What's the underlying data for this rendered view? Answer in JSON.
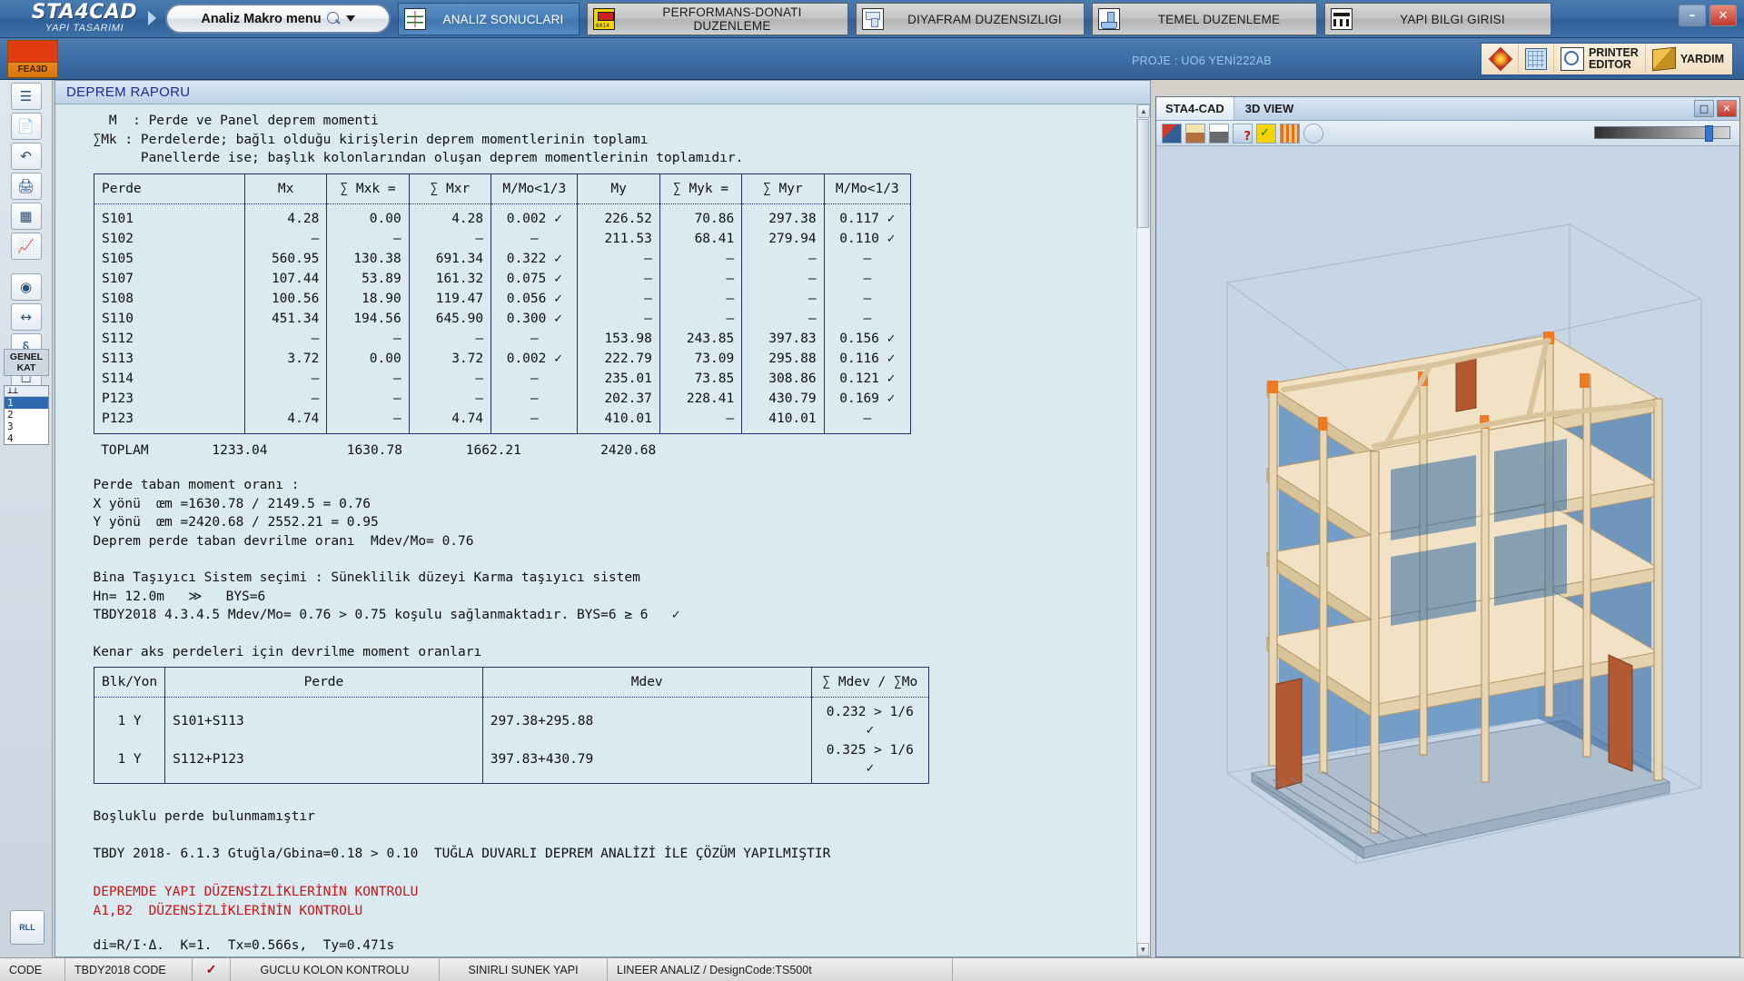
{
  "app": {
    "brand_line1": "STA4CAD",
    "brand_line2": "YAPI TASARIMI",
    "macro_menu": "Analiz Makro menu",
    "project_label": "PROJE : UO6 YENİ222AB",
    "fea3d_label": "FEA3D"
  },
  "window_buttons": {
    "minimize": "–",
    "close": "✕"
  },
  "ribbon_tabs": [
    {
      "label": "ANALIZ SONUCLARI",
      "icon": "analysis-chart-icon",
      "active": true
    },
    {
      "label": "PERFORMANS-DONATI DUZENLEME",
      "icon": "rebar-editor-icon",
      "active": false
    },
    {
      "label": "DIYAFRAM DUZENSIZLIGI",
      "icon": "diaphragm-icon",
      "active": false
    },
    {
      "label": "TEMEL DUZENLEME",
      "icon": "foundation-icon",
      "active": false
    },
    {
      "label": "YAPI BILGI GIRISI",
      "icon": "building-input-icon",
      "active": false
    }
  ],
  "right_tools": [
    {
      "label": "",
      "icon": "render-diamond-icon"
    },
    {
      "label": "",
      "icon": "3d-model-icon"
    },
    {
      "label_line1": "PRINTER",
      "label_line2": "EDITOR",
      "icon": "printer-preview-icon"
    },
    {
      "label": "YARDIM",
      "icon": "help-book-icon"
    }
  ],
  "rail": {
    "icons": [
      "layers-icon",
      "document-icon",
      "undo-icon",
      "print-icon",
      "table-grid-icon",
      "chart-icon",
      "color-wheel-icon",
      "dimension-icon",
      "section-icon",
      "square-select-icon"
    ],
    "genel_kat_line1": "GENEL",
    "genel_kat_line2": "KAT",
    "kat_header": "⊥⊥",
    "kat_items": [
      "1",
      "2",
      "3",
      "4"
    ],
    "kat_selected": "1",
    "rll_label": "RLL"
  },
  "report": {
    "title": "DEPREM RAPORU",
    "legend": "    M  : Perde ve Panel deprem momenti\n  ∑Mk : Perdelerde; bağlı olduğu kirişlerin deprem momentlerinin toplamı\n        Panellerde ise; başlık kolonlarından oluşan deprem momentlerinin toplamıdır.",
    "table1": {
      "headers": [
        "Perde",
        "Mx",
        "∑ Mxk =",
        "∑ Mxr",
        "M/Mo<1/3",
        "My",
        "∑ Myk =",
        "∑ Myr",
        "M/Mo<1/3"
      ],
      "rows": [
        [
          "S101",
          "4.28",
          "0.00",
          "4.28",
          "0.002 ✓",
          "226.52",
          "70.86",
          "297.38",
          "0.117 ✓"
        ],
        [
          "S102",
          "–",
          "–",
          "–",
          "–",
          "211.53",
          "68.41",
          "279.94",
          "0.110 ✓"
        ],
        [
          "S105",
          "560.95",
          "130.38",
          "691.34",
          "0.322 ✓",
          "–",
          "–",
          "–",
          "–"
        ],
        [
          "S107",
          "107.44",
          "53.89",
          "161.32",
          "0.075 ✓",
          "–",
          "–",
          "–",
          "–"
        ],
        [
          "S108",
          "100.56",
          "18.90",
          "119.47",
          "0.056 ✓",
          "–",
          "–",
          "–",
          "–"
        ],
        [
          "S110",
          "451.34",
          "194.56",
          "645.90",
          "0.300 ✓",
          "–",
          "–",
          "–",
          "–"
        ],
        [
          "S112",
          "–",
          "–",
          "–",
          "–",
          "153.98",
          "243.85",
          "397.83",
          "0.156 ✓"
        ],
        [
          "S113",
          "3.72",
          "0.00",
          "3.72",
          "0.002 ✓",
          "222.79",
          "73.09",
          "295.88",
          "0.116 ✓"
        ],
        [
          "S114",
          "–",
          "–",
          "–",
          "–",
          "235.01",
          "73.85",
          "308.86",
          "0.121 ✓"
        ],
        [
          "P123",
          "–",
          "–",
          "–",
          "–",
          "202.37",
          "228.41",
          "430.79",
          "0.169 ✓"
        ],
        [
          "P123",
          "4.74",
          "–",
          "4.74",
          "–",
          "410.01",
          "–",
          "410.01",
          "–"
        ]
      ]
    },
    "toplam_line": "   TOPLAM        1233.04          1630.78        1662.21          2420.68",
    "ratios_block": "  Perde taban moment oranı :\n  X yönü  œm =1630.78 / 2149.5 = 0.76\n  Y yönü  œm =2420.68 / 2552.21 = 0.95\n  Deprem perde taban devrilme oranı  Mdev/Mo= 0.76",
    "system_block": "  Bina Taşıyıcı Sistem seçimi : Süneklilik düzeyi Karma taşıyıcı sistem\n  Hn= 12.0m   ≫   BYS=6\n  TBDY2018 4.3.4.5 Mdev/Mo= 0.76 > 0.75 koşulu sağlanmaktadır. BYS=6 ≥ 6   ✓",
    "edge_axis_heading": "  Kenar aks perdeleri için devrilme moment oranları",
    "table2": {
      "headers": [
        "Blk/Yon",
        "Perde",
        "Mdev",
        "∑ Mdev / ∑Mo"
      ],
      "rows": [
        [
          "1   Y",
          "S101+S113",
          "297.38+295.88",
          "0.232 > 1/6 ✓"
        ],
        [
          "1   Y",
          "S112+P123",
          "397.83+430.79",
          "0.325 > 1/6 ✓"
        ]
      ]
    },
    "bosluklu_line": "  Boşluklu perde bulunmamıştır",
    "tbdy_line": "  TBDY 2018- 6.1.3 Gtuğla/Gbina=0.18 > 0.10  TUĞLA DUVARLI DEPREM ANALİZİ İLE ÇÖZÜM YAPILMIŞTIR",
    "red_block": "  DEPREMDE YAPI DÜZENSİZLİKLERİNİN KONTROLU\n  A1,B2  DÜZENSİZLİKLERİNİN KONTROLU",
    "last_line": "  di=R/I·Δ.  K=1.  Tx=0.566s,  Ty=0.471s"
  },
  "view3d": {
    "title_left": "STA4-CAD",
    "title_right": "3D VIEW",
    "restore_glyph": "□",
    "close_glyph": "✕",
    "toolbar_icons": [
      "grid-snap-icon",
      "home-view-icon",
      "print-view-icon",
      "help-query-icon",
      "check-grid-icon",
      "hatch-icon",
      "pan-icon"
    ]
  },
  "status_bar": [
    {
      "label": "CODE",
      "name": "status-code"
    },
    {
      "label": "TBDY2018 CODE",
      "name": "status-tbdy"
    },
    {
      "label": "✓",
      "name": "status-check"
    },
    {
      "label": "GUCLU KOLON KONTROLU",
      "name": "status-guclu-kolon"
    },
    {
      "label": "SINIRLI SUNEK YAPI",
      "name": "status-sinirli-sunek"
    },
    {
      "label": "LINEER ANALIZ / DesignCode:TS500t",
      "name": "status-lineer-analiz"
    },
    {
      "label": "",
      "name": "status-empty"
    }
  ],
  "colors": {
    "accent_blue": "#3d6ea6",
    "report_bg": "#dbeaf1",
    "report_title": "#23239c",
    "red_text": "#c81414",
    "active_tab": "#4a80b8"
  }
}
